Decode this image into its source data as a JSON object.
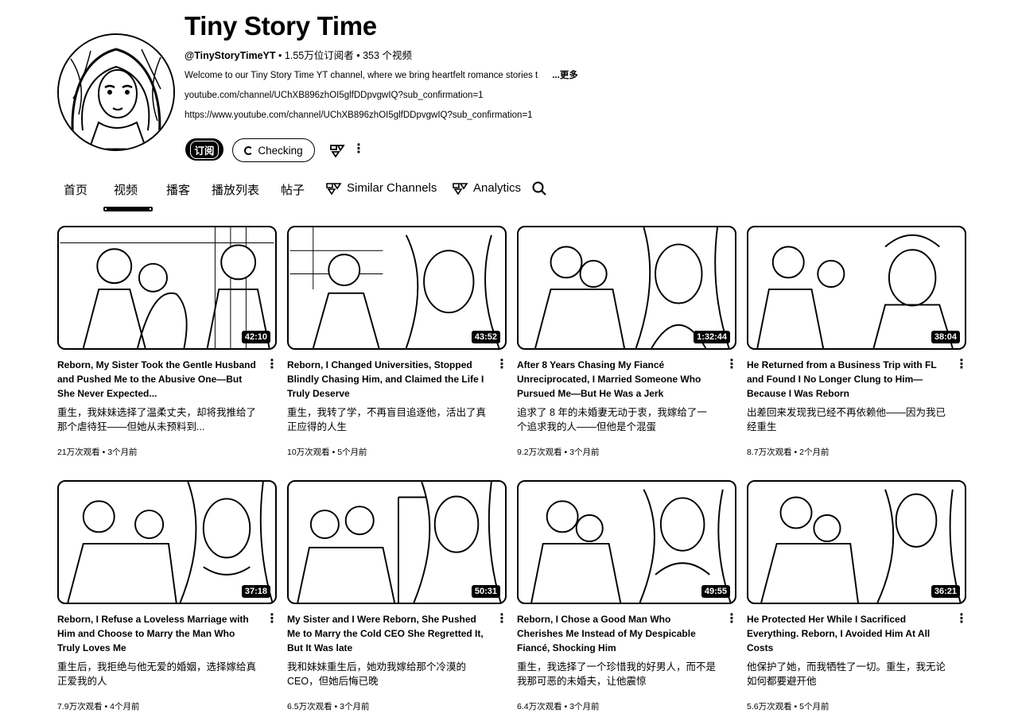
{
  "channel": {
    "title": "Tiny Story Time",
    "handle": "@TinyStoryTimeYT",
    "subscribers": "1.55万位订阅者",
    "video_count": "353 个视频",
    "description": "Welcome to our Tiny Story Time YT channel, where we bring heartfelt romance stories t",
    "more_label": "...更多",
    "link1": "youtube.com/channel/UChXB896zhOI5glfDDpvgwIQ?sub_confirmation=1",
    "link2": "https://www.youtube.com/channel/UChXB896zhOI5glfDDpvgwIQ?sub_confirmation=1",
    "subscribe_label": "订阅",
    "checking_label": "Checking"
  },
  "tabs": [
    {
      "label": "首页"
    },
    {
      "label": "视频"
    },
    {
      "label": "播客"
    },
    {
      "label": "播放列表"
    },
    {
      "label": "帖子"
    },
    {
      "label": "Similar Channels"
    },
    {
      "label": "Analytics"
    }
  ],
  "videos": [
    {
      "title": "Reborn, My Sister Took the Gentle Husband and Pushed Me to the Abusive One—But She Never Expected...",
      "title_zh": "重生，我妹妹选择了温柔丈夫，却将我推给了那个虐待狂——但她从未预料到...",
      "duration": "42:10",
      "views": "21万次观看",
      "age": "3个月前"
    },
    {
      "title": "Reborn, I Changed Universities, Stopped Blindly Chasing Him, and Claimed the Life I Truly Deserve",
      "title_zh": "重生，我转了学，不再盲目追逐他，活出了真正应得的人生",
      "duration": "43:52",
      "views": "10万次观看",
      "age": "5个月前"
    },
    {
      "title": "After 8 Years Chasing My Fiancé Unreciprocated, I Married Someone Who Pursued Me—But He Was a Jerk",
      "title_zh": "追求了 8 年的未婚妻无动于衷，我嫁给了一个追求我的人——但他是个混蛋",
      "duration": "1:32:44",
      "views": "9.2万次观看",
      "age": "3个月前"
    },
    {
      "title": "He Returned from a Business Trip with FL and Found I No Longer Clung to Him—Because I Was Reborn",
      "title_zh": "出差回来发现我已经不再依赖他——因为我已经重生",
      "duration": "38:04",
      "views": "8.7万次观看",
      "age": "2个月前"
    },
    {
      "title": "Reborn, I Refuse a Loveless Marriage with Him and Choose to Marry the Man Who Truly Loves Me",
      "title_zh": "重生后，我拒绝与他无爱的婚姻，选择嫁给真正爱我的人",
      "duration": "37:18",
      "views": "7.9万次观看",
      "age": "4个月前"
    },
    {
      "title": "My Sister and I Were Reborn, She Pushed Me to Marry the Cold CEO She Regretted It, But It Was late",
      "title_zh": "我和妹妹重生后，她劝我嫁给那个冷漠的CEO，但她后悔已晚",
      "duration": "50:31",
      "views": "6.5万次观看",
      "age": "3个月前"
    },
    {
      "title": "Reborn, I Chose a Good Man Who Cherishes Me Instead of My Despicable Fiancé, Shocking Him",
      "title_zh": "重生，我选择了一个珍惜我的好男人，而不是我那可恶的未婚夫，让他震惊",
      "duration": "49:55",
      "views": "6.4万次观看",
      "age": "3个月前"
    },
    {
      "title": "He Protected Her While I Sacrificed Everything. Reborn, I Avoided Him At All Costs",
      "title_zh": "他保护了她，而我牺牲了一切。重生，我无论如何都要避开他",
      "duration": "36:21",
      "views": "5.6万次观看",
      "age": "5个月前"
    }
  ]
}
